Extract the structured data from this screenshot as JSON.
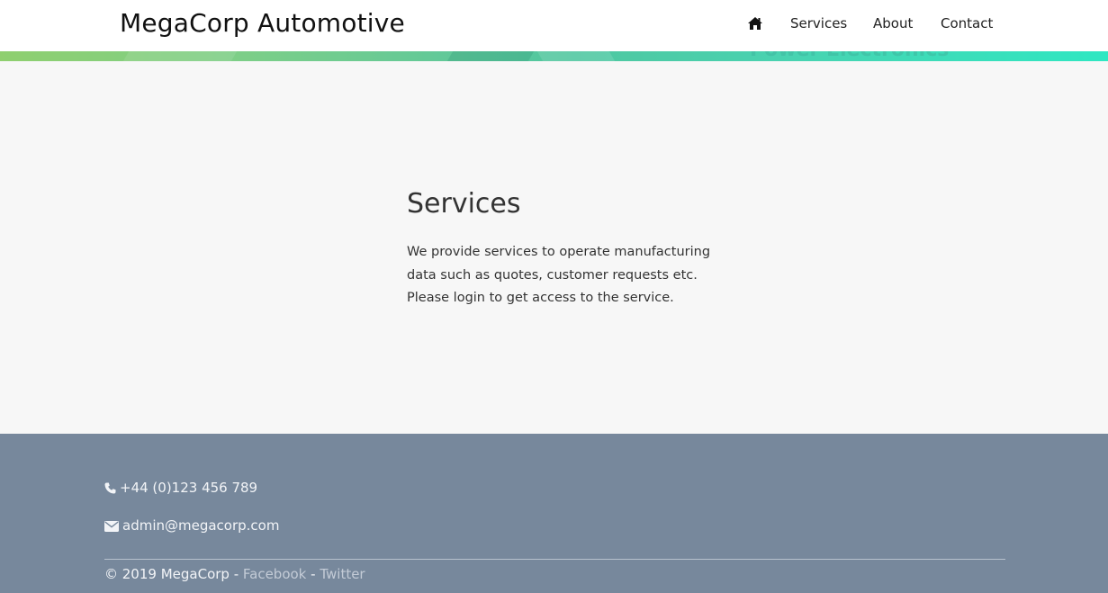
{
  "header": {
    "brand": "MegaCorp Automotive",
    "nav": {
      "home_icon": "home-icon",
      "services": "Services",
      "about": "About",
      "contact": "Contact"
    }
  },
  "banner": {
    "partial_text": "Power Electronics",
    "colors": [
      "#8fcf6f",
      "#4fc7a0",
      "#2fe7c2"
    ]
  },
  "main": {
    "title": "Services",
    "body_lines": [
      "We provide services to operate manufacturing",
      "data such as quotes, customer requests etc.",
      "Please login to get access to the service."
    ]
  },
  "footer": {
    "phone_icon": "phone-icon",
    "phone": "+44 (0)123 456 789",
    "email_icon": "envelope-icon",
    "email": "admin@megacorp.com",
    "copyright": "© 2019 MegaCorp - ",
    "facebook": "Facebook",
    "separator": " - ",
    "twitter": "Twitter",
    "background_color": "#77889c"
  }
}
